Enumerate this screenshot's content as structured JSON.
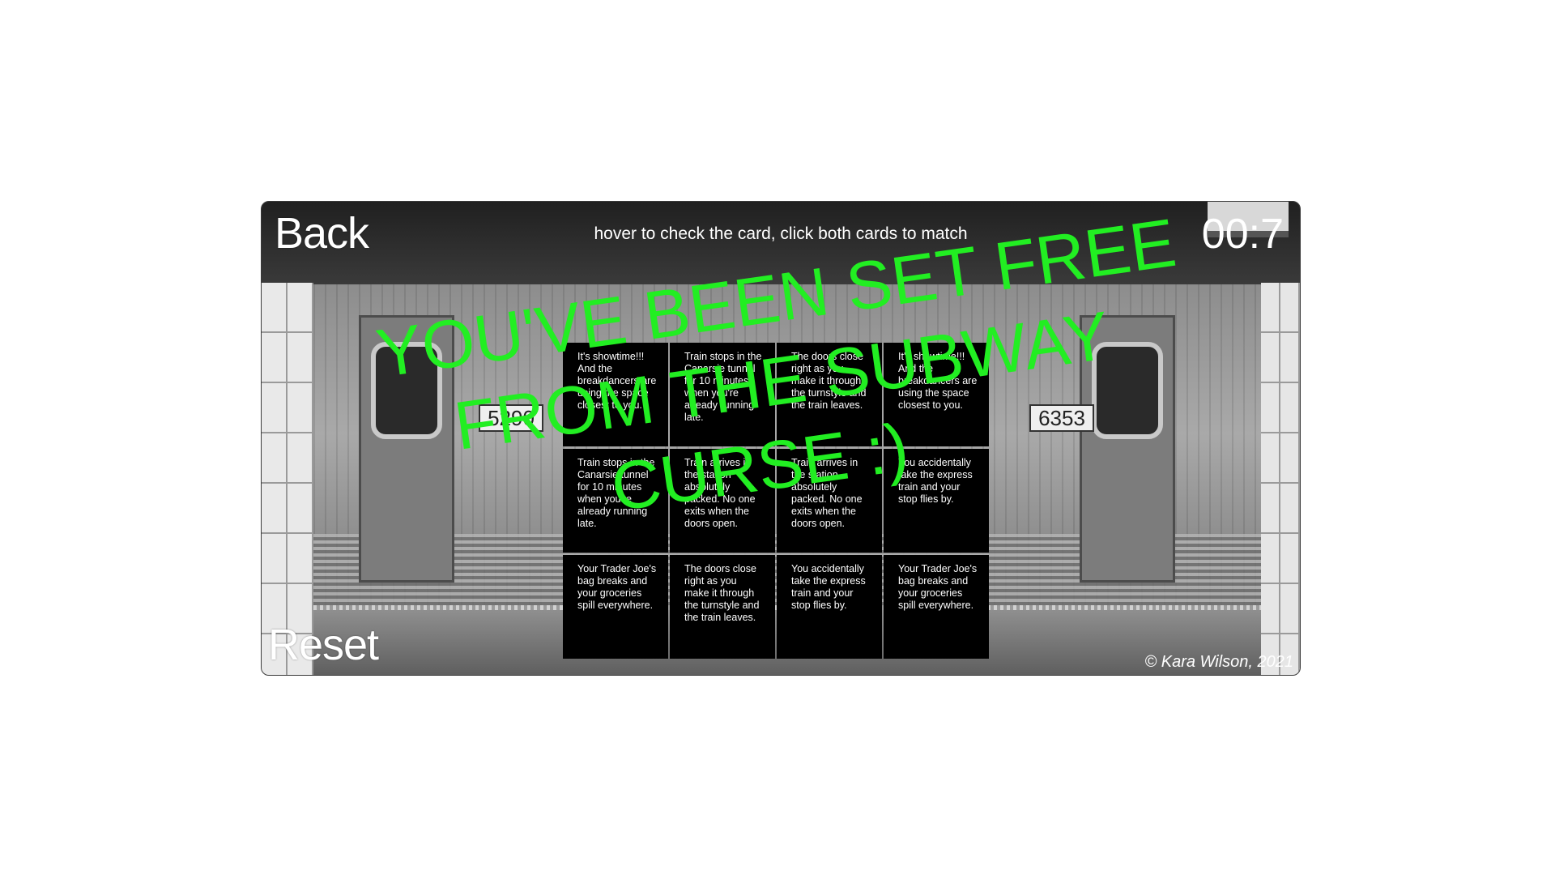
{
  "hud": {
    "back_label": "Back",
    "reset_label": "Reset",
    "timer": "00:7",
    "instructions": "hover to check the card, click both cards to match",
    "copyright": "© Kara Wilson, 2021"
  },
  "cards": [
    "It's showtime!!! And the breakdancers are using the space closest to you.",
    "Train stops in the Canarsie tunnel for 10 minutes when you're already running late.",
    "The doors close right as you make it through the turnstyle and the train leaves.",
    "It's showtime!!! And the breakdancers are using the space closest to you.",
    "Train stops in the Canarsie tunnel for 10 minutes when you're already running late.",
    "Train arrives in the station absolutely packed. No one exits when the doors open.",
    "Train arrives in the station absolutely packed. No one exits when the doors open.",
    "You accidentally take the express train and your stop flies by.",
    "Your Trader Joe's bag breaks and your groceries spill everywhere.",
    "The doors close right as you make it through the turnstyle and the train leaves.",
    "You accidentally take the express train and your stop flies by.",
    "Your Trader Joe's bag breaks and your groceries spill everywhere."
  ],
  "win": {
    "lines": [
      "YOU'VE BEEN SET FREE",
      "FROM THE SUBWAY",
      "CURSE :)"
    ],
    "color": "#22ee22"
  },
  "background": {
    "car_numbers": [
      "5290",
      "6353"
    ]
  }
}
